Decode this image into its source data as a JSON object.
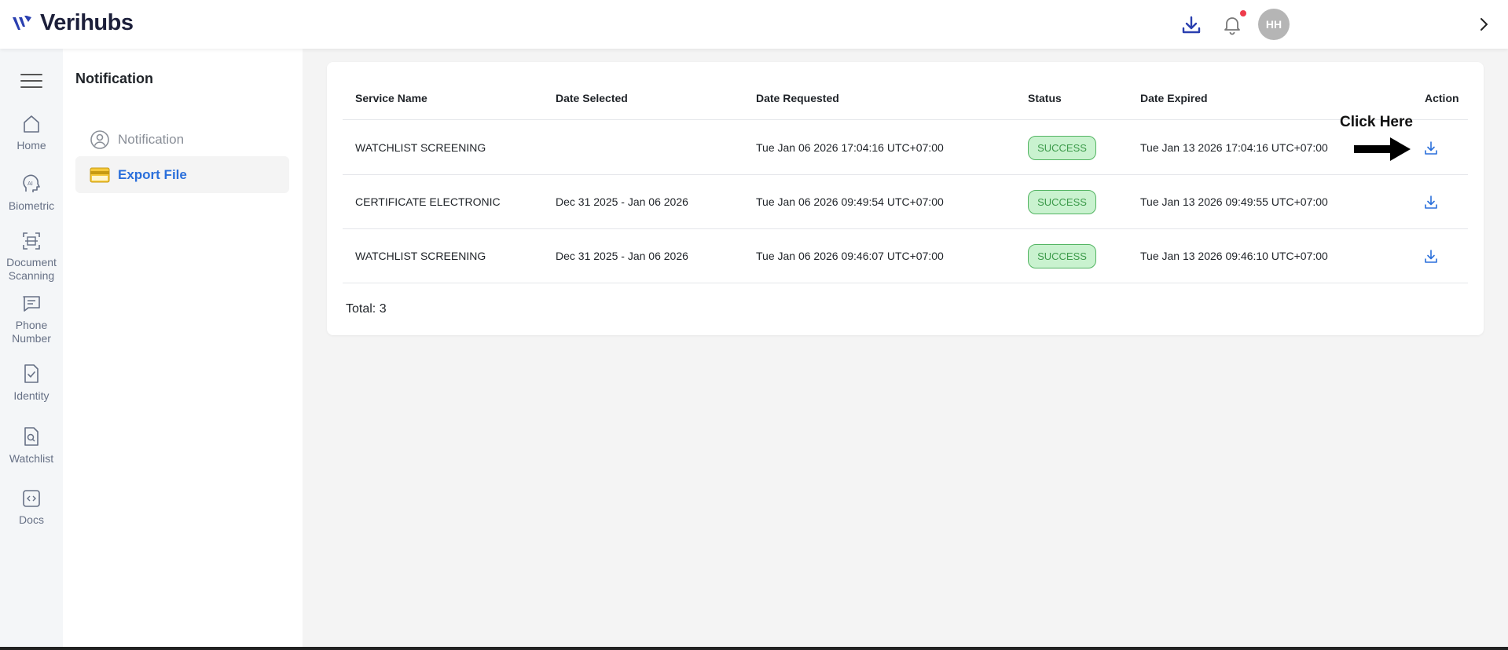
{
  "header": {
    "brand": "Verihubs",
    "avatar_initials": "HH",
    "icons": [
      "download-icon",
      "bell-icon",
      "chevron-right-icon"
    ],
    "notification_dot_color": "#ee3b4b"
  },
  "rail": {
    "items": [
      {
        "label_line1": "Home",
        "label_line2": "",
        "icon": "home-icon"
      },
      {
        "label_line1": "Biometric",
        "label_line2": "",
        "icon": "ai-head-icon"
      },
      {
        "label_line1": "Document",
        "label_line2": "Scanning",
        "icon": "scan-icon"
      },
      {
        "label_line1": "Phone",
        "label_line2": "Number",
        "icon": "message-icon"
      },
      {
        "label_line1": "Identity",
        "label_line2": "",
        "icon": "id-check-icon"
      },
      {
        "label_line1": "Watchlist",
        "label_line2": "",
        "icon": "doc-search-icon"
      },
      {
        "label_line1": "Docs",
        "label_line2": "",
        "icon": "code-icon"
      }
    ]
  },
  "subsidebar": {
    "title": "Notification",
    "items": [
      {
        "label": "Notification",
        "icon": "user-circle-icon",
        "active": false
      },
      {
        "label": "Export File",
        "icon": "card-icon",
        "active": true
      }
    ]
  },
  "table": {
    "headers": [
      "Service Name",
      "Date Selected",
      "Date Requested",
      "Status",
      "Date Expired",
      "Action"
    ],
    "rows": [
      {
        "service": "WATCHLIST SCREENING",
        "selected": "",
        "requested": "Tue Jan 06 2026 17:04:16 UTC+07:00",
        "status": "SUCCESS",
        "expired": "Tue Jan 13 2026 17:04:16 UTC+07:00"
      },
      {
        "service": "CERTIFICATE ELECTRONIC",
        "selected": "Dec 31 2025 - Jan 06 2026",
        "requested": "Tue Jan 06 2026 09:49:54 UTC+07:00",
        "status": "SUCCESS",
        "expired": "Tue Jan 13 2026 09:49:55 UTC+07:00"
      },
      {
        "service": "WATCHLIST SCREENING",
        "selected": "Dec 31 2025 - Jan 06 2026",
        "requested": "Tue Jan 06 2026 09:46:07 UTC+07:00",
        "status": "SUCCESS",
        "expired": "Tue Jan 13 2026 09:46:10 UTC+07:00"
      }
    ],
    "total": "Total: 3"
  },
  "annotation": {
    "text": "Click Here"
  },
  "colors": {
    "accent": "#2a6fdb",
    "success_bg": "#c9f2cf",
    "success_border": "#53b462",
    "success_text": "#3c9a4a"
  }
}
